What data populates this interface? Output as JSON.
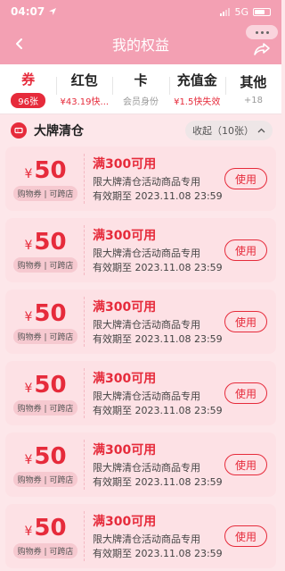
{
  "status_bar": {
    "time": "04:07",
    "network": "5G"
  },
  "header": {
    "title": "我的权益"
  },
  "tabs": [
    {
      "label": "券",
      "sub": "96张",
      "active": true
    },
    {
      "label": "红包",
      "sub": "¥43.19快...",
      "active": false
    },
    {
      "label": "卡",
      "sub": "会员身份",
      "active": false
    },
    {
      "label": "充值金",
      "sub": "¥1.5快失效",
      "active": false
    },
    {
      "label": "其他",
      "sub": "+18",
      "active": false
    }
  ],
  "section": {
    "title": "大牌清仓",
    "collapse_label": "收起（10张）"
  },
  "coupons": [
    {
      "currency": "¥",
      "amount": "50",
      "scope": "购物券 | 可跨店",
      "title": "满300可用",
      "desc": "限大牌清仓活动商品专用",
      "expiry": "有效期至 2023.11.08 23:59",
      "action": "使用"
    },
    {
      "currency": "¥",
      "amount": "50",
      "scope": "购物券 | 可跨店",
      "title": "满300可用",
      "desc": "限大牌清仓活动商品专用",
      "expiry": "有效期至 2023.11.08 23:59",
      "action": "使用"
    },
    {
      "currency": "¥",
      "amount": "50",
      "scope": "购物券 | 可跨店",
      "title": "满300可用",
      "desc": "限大牌清仓活动商品专用",
      "expiry": "有效期至 2023.11.08 23:59",
      "action": "使用"
    },
    {
      "currency": "¥",
      "amount": "50",
      "scope": "购物券 | 可跨店",
      "title": "满300可用",
      "desc": "限大牌清仓活动商品专用",
      "expiry": "有效期至 2023.11.08 23:59",
      "action": "使用"
    },
    {
      "currency": "¥",
      "amount": "50",
      "scope": "购物券 | 可跨店",
      "title": "满300可用",
      "desc": "限大牌清仓活动商品专用",
      "expiry": "有效期至 2023.11.08 23:59",
      "action": "使用"
    },
    {
      "currency": "¥",
      "amount": "50",
      "scope": "购物券 | 可跨店",
      "title": "满300可用",
      "desc": "限大牌清仓活动商品专用",
      "expiry": "有效期至 2023.11.08 23:59",
      "action": "使用"
    }
  ],
  "colors": {
    "accent": "#e62b3b",
    "header_bg": "#f3a0b3",
    "page_bg": "#fde7ea",
    "coupon_bg": "#fde1e5"
  },
  "icons": {
    "back": "back-arrow-icon",
    "share": "share-icon",
    "more": "more-dots-icon",
    "section": "ticket-icon"
  }
}
